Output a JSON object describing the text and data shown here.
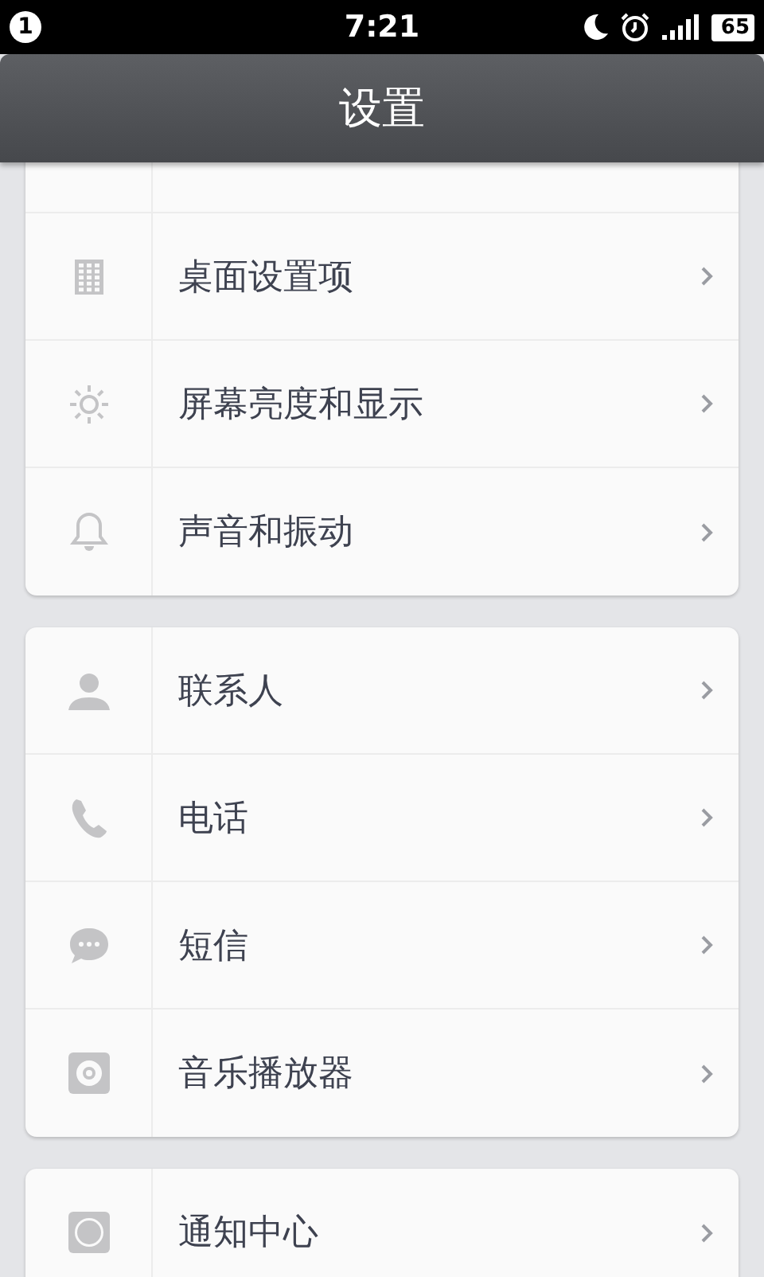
{
  "status_bar": {
    "notification_count": "1",
    "time": "7:21",
    "battery": "65"
  },
  "title": "设置",
  "groups": [
    {
      "items": [
        {
          "kind": "covered"
        },
        {
          "kind": "link",
          "label": "桌面设置项"
        },
        {
          "kind": "link",
          "label": "屏幕亮度和显示"
        },
        {
          "kind": "link",
          "label": "声音和振动"
        }
      ]
    },
    {
      "items": [
        {
          "kind": "link",
          "label": "联系人"
        },
        {
          "kind": "link",
          "label": "电话"
        },
        {
          "kind": "link",
          "label": "短信"
        },
        {
          "kind": "link",
          "label": "音乐播放器"
        }
      ]
    },
    {
      "items": [
        {
          "kind": "link",
          "label": "通知中心"
        }
      ]
    }
  ]
}
